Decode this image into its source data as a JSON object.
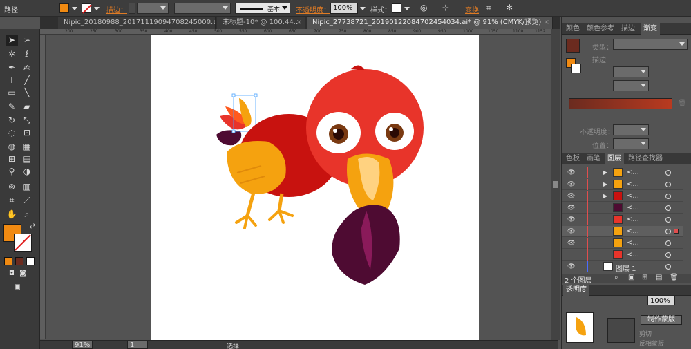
{
  "control_bar": {
    "object_type": "路径",
    "stroke_label": "描边：",
    "stroke_style": "基本",
    "opacity_label": "不透明度：",
    "opacity_value": "100%",
    "style_label": "样式：",
    "transform_label": "变换",
    "fill_color": "#f08a12"
  },
  "tabs": [
    {
      "label": "Nipic_20180988_20171119094708245000.ai*",
      "close": "×"
    },
    {
      "label": "未标题-10* @ 100.44...",
      "close": "×"
    },
    {
      "label": "Nipic_27738721_20190122084702454034.ai* @ 91% (CMYK/预览)",
      "close": "×"
    }
  ],
  "ruler": [
    "200",
    "250",
    "300",
    "350",
    "400",
    "450",
    "500",
    "550",
    "600",
    "650",
    "700",
    "750",
    "800",
    "850",
    "900",
    "950",
    "1000",
    "1050",
    "1100",
    "1152"
  ],
  "status_bar": {
    "zoom": "91%",
    "page": "1",
    "tool": "选择"
  },
  "color_panel": {
    "tabs": [
      "颜色",
      "颜色参考",
      "描边",
      "渐变"
    ],
    "type_label": "类型：",
    "stroke_label": "描边",
    "opacity_label": "不透明度：",
    "position_label": "位置："
  },
  "layers_panel": {
    "tabs": [
      "色板",
      "画笔",
      "图层",
      "路径查找器"
    ],
    "rows": [
      {
        "name": "<...",
        "expand": "▶",
        "thumb": "orange"
      },
      {
        "name": "<...",
        "expand": "▶",
        "thumb": "orange"
      },
      {
        "name": "<...",
        "expand": "▶",
        "thumb": "red"
      },
      {
        "name": "<...",
        "expand": "",
        "thumb": "dark"
      },
      {
        "name": "<...",
        "expand": "",
        "thumb": "red"
      },
      {
        "name": "<...",
        "expand": "",
        "thumb": "orange"
      },
      {
        "name": "<...",
        "expand": "",
        "thumb": "orange"
      },
      {
        "name": "<...",
        "expand": "",
        "thumb": "red"
      },
      {
        "name": "<...",
        "expand": "",
        "thumb": "white"
      }
    ],
    "layer_name": "图层 1",
    "layer_count": "2 个图层"
  },
  "transparency_panel": {
    "opacity_value": "100%",
    "make_mask": "制作蒙版",
    "clip": "剪切",
    "invert_mask": "反相蒙版",
    "tab_label": "透明度"
  },
  "colors": {
    "accent": "#f08a12",
    "gradient_start": "#6b2b1f",
    "gradient_end": "#b93a20",
    "red": "#e8342a",
    "plum": "#4e0b32"
  }
}
